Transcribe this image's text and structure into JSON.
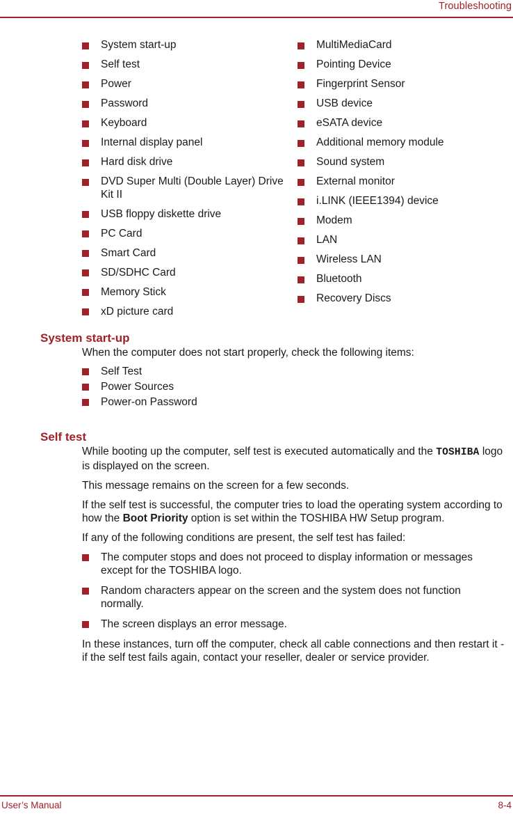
{
  "colors": {
    "accent": "#a02128",
    "text": "#1a1a1a",
    "background": "#ffffff"
  },
  "header": {
    "title": "Troubleshooting"
  },
  "footer": {
    "left": "User’s Manual",
    "right": "8-4"
  },
  "topic_list": {
    "left_column": [
      "System start-up",
      "Self test",
      "Power",
      "Password",
      "Keyboard",
      "Internal display panel",
      "Hard disk drive",
      "DVD Super Multi (Double Layer) Drive Kit II",
      "USB floppy diskette drive",
      "PC Card",
      "Smart Card",
      "SD/SDHC Card",
      "Memory Stick",
      "xD picture card"
    ],
    "right_column": [
      "MultiMediaCard",
      "Pointing Device",
      "Fingerprint Sensor",
      "USB device",
      "eSATA device",
      "Additional memory module",
      "Sound system",
      "External monitor",
      "i.LINK (IEEE1394) device",
      "Modem",
      "LAN",
      "Wireless LAN",
      "Bluetooth",
      "Recovery Discs"
    ]
  },
  "sections": [
    {
      "heading": "System start-up",
      "intro": "When the computer does not start properly, check the following items:",
      "bullets": [
        "Self Test",
        "Power Sources",
        "Power-on Password"
      ]
    },
    {
      "heading": "Self test",
      "para1_before": "While booting up the computer, self test is executed automatically and the ",
      "para1_mono": "TOSHIBA",
      "para1_after": " logo is displayed on the screen.",
      "para2": "This message remains on the screen for a few seconds.",
      "para3_before": "If the self test is successful, the computer tries to load the operating system according to how the ",
      "para3_bold": "Boot Priority",
      "para3_after": " option is set within the TOSHIBA HW Setup program.",
      "para4": "If any of the following conditions are present, the self test has failed:",
      "bullets": [
        "The computer stops and does not proceed to display information or messages except for the TOSHIBA logo.",
        "Random characters appear on the screen and the system does not function normally.",
        "The screen displays an error message."
      ],
      "para5": "In these instances, turn off the computer, check all cable connections and then restart it - if the self test fails again, contact your reseller, dealer or service provider."
    }
  ]
}
